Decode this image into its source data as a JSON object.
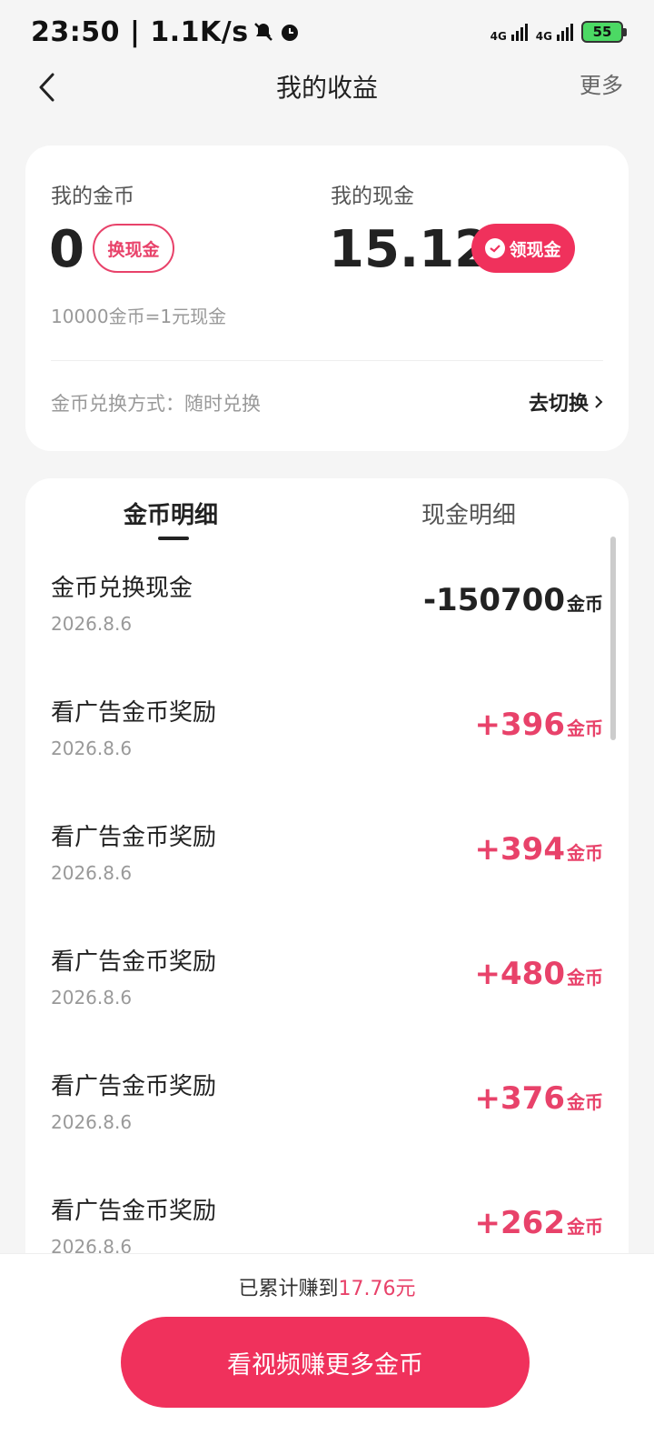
{
  "status_bar": {
    "time": "23:50",
    "speed": "1.1K/s",
    "net1": "4G",
    "net2": "4G",
    "battery": "55"
  },
  "header": {
    "title": "我的收益",
    "more_label": "更多"
  },
  "summary": {
    "coin_label": "我的金币",
    "coin_value": "0",
    "exchange_label": "换现金",
    "cash_label": "我的现金",
    "cash_value": "15.12",
    "withdraw_label": "领现金",
    "rate_text": "10000金币=1元现金",
    "method_text": "金币兑换方式：随时兑换",
    "switch_label": "去切换"
  },
  "tabs": [
    {
      "label": "金币明细",
      "active": true
    },
    {
      "label": "现金明细",
      "active": false
    }
  ],
  "records": [
    {
      "title": "金币兑换现金",
      "date": "2026.8.6",
      "amount": "-150700",
      "unit": "金币",
      "sign": "neg"
    },
    {
      "title": "看广告金币奖励",
      "date": "2026.8.6",
      "amount": "+396",
      "unit": "金币",
      "sign": "pos"
    },
    {
      "title": "看广告金币奖励",
      "date": "2026.8.6",
      "amount": "+394",
      "unit": "金币",
      "sign": "pos"
    },
    {
      "title": "看广告金币奖励",
      "date": "2026.8.6",
      "amount": "+480",
      "unit": "金币",
      "sign": "pos"
    },
    {
      "title": "看广告金币奖励",
      "date": "2026.8.6",
      "amount": "+376",
      "unit": "金币",
      "sign": "pos"
    },
    {
      "title": "看广告金币奖励",
      "date": "2026.8.6",
      "amount": "+262",
      "unit": "金币",
      "sign": "pos"
    }
  ],
  "footer": {
    "earned_prefix": "已累计赚到",
    "earned_amount": "17.76元",
    "watch_label": "看视频赚更多金币"
  },
  "colors": {
    "accent": "#f0315c",
    "accent_text": "#e8426a"
  }
}
